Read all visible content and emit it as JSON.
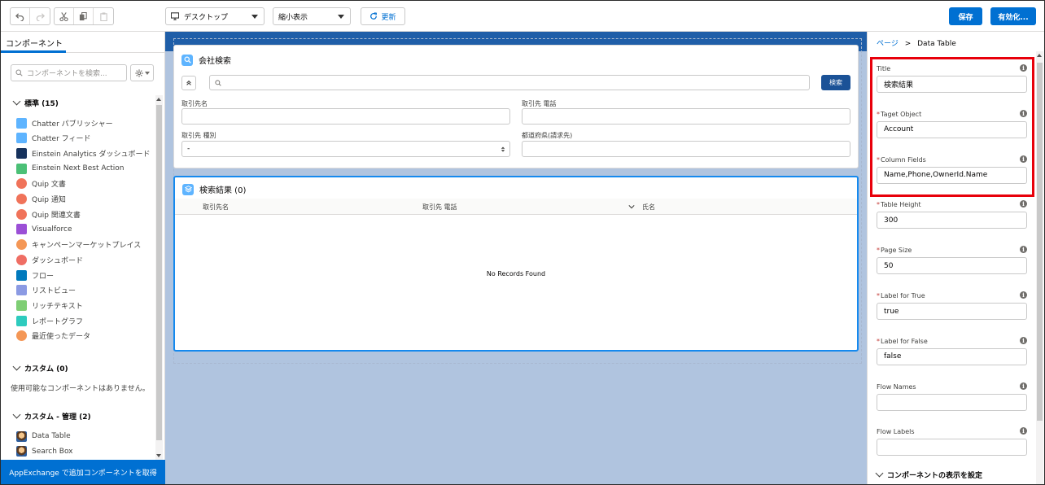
{
  "toolbar": {
    "device_select": "デスクトップ",
    "view_select": "縮小表示",
    "refresh_label": "更新",
    "save_label": "保存",
    "activate_label": "有効化..."
  },
  "left_panel": {
    "tab_label": "コンポーネント",
    "search_placeholder": "コンポーネントを検索...",
    "standard_header": "標準 (15)",
    "standard_items": [
      {
        "label": "Chatter パブリッシャー",
        "icon": "bolt-icon",
        "color": "#5eb4ff"
      },
      {
        "label": "Chatter フィード",
        "icon": "feed-icon",
        "color": "#5eb4ff"
      },
      {
        "label": "Einstein Analytics ダッシュボード",
        "icon": "bar-chart-icon",
        "color": "#16325c"
      },
      {
        "label": "Einstein Next Best Action",
        "icon": "user-icon",
        "color": "#4bc076"
      },
      {
        "label": "Quip 文書",
        "icon": "quip-icon",
        "color": "#f0735a"
      },
      {
        "label": "Quip 通知",
        "icon": "quip-icon",
        "color": "#f0735a"
      },
      {
        "label": "Quip 関連文書",
        "icon": "quip-icon",
        "color": "#f0735a"
      },
      {
        "label": "Visualforce",
        "icon": "code-icon",
        "color": "#9b4fd6"
      },
      {
        "label": "キャンペーンマーケットプレイス",
        "icon": "target-icon",
        "color": "#f49756"
      },
      {
        "label": "ダッシュボード",
        "icon": "gauge-icon",
        "color": "#ef6e64"
      },
      {
        "label": "フロー",
        "icon": "flow-icon",
        "color": "#0079bc"
      },
      {
        "label": "リストビュー",
        "icon": "list-icon",
        "color": "#8b9ae3"
      },
      {
        "label": "リッチテキスト",
        "icon": "text-icon",
        "color": "#7ece74"
      },
      {
        "label": "レポートグラフ",
        "icon": "line-chart-icon",
        "color": "#2ecbbe"
      },
      {
        "label": "最近使ったデータ",
        "icon": "clock-icon",
        "color": "#f49756"
      }
    ],
    "custom_header": "カスタム (0)",
    "custom_empty": "使用可能なコンポーネントはありません。",
    "managed_header": "カスタム - 管理 (2)",
    "managed_items": [
      {
        "label": "Data Table",
        "icon": "avatar-icon"
      },
      {
        "label": "Search Box",
        "icon": "avatar-icon"
      }
    ],
    "appexchange_label": "AppExchange で追加コンポーネントを取得"
  },
  "canvas": {
    "search_card": {
      "title": "会社検索",
      "search_button": "検索",
      "fields": [
        {
          "label": "取引先名",
          "value": ""
        },
        {
          "label": "取引先 電話",
          "value": ""
        },
        {
          "label": "取引先 種別",
          "value": "-"
        },
        {
          "label": "都道府県(請求先)",
          "value": ""
        }
      ]
    },
    "results_card": {
      "title": "検索結果 (0)",
      "columns": [
        "取引先名",
        "取引先 電話",
        "氏名"
      ],
      "empty_text": "No Records Found"
    }
  },
  "right_panel": {
    "breadcrumb_link": "ページ",
    "breadcrumb_sep": ">",
    "breadcrumb_current": "Data Table",
    "properties": [
      {
        "label": "Title",
        "required": false,
        "value": "検索結果"
      },
      {
        "label": "Taget Object",
        "required": true,
        "value": "Account"
      },
      {
        "label": "Column Fields",
        "required": true,
        "value": "Name,Phone,OwnerId.Name"
      },
      {
        "label": "Table Height",
        "required": true,
        "value": "300"
      },
      {
        "label": "Page Size",
        "required": true,
        "value": "50"
      },
      {
        "label": "Label for True",
        "required": true,
        "value": "true"
      },
      {
        "label": "Label for False",
        "required": true,
        "value": "false"
      },
      {
        "label": "Flow Names",
        "required": false,
        "value": ""
      },
      {
        "label": "Flow Labels",
        "required": false,
        "value": ""
      }
    ],
    "visibility_section": "コンポーネントの表示を設定",
    "required_mark": "*",
    "info_glyph": "i"
  },
  "colors": {
    "brand": "#0070d2",
    "highlight_box": "#e8000b",
    "canvas_bg": "#b0c4df"
  }
}
